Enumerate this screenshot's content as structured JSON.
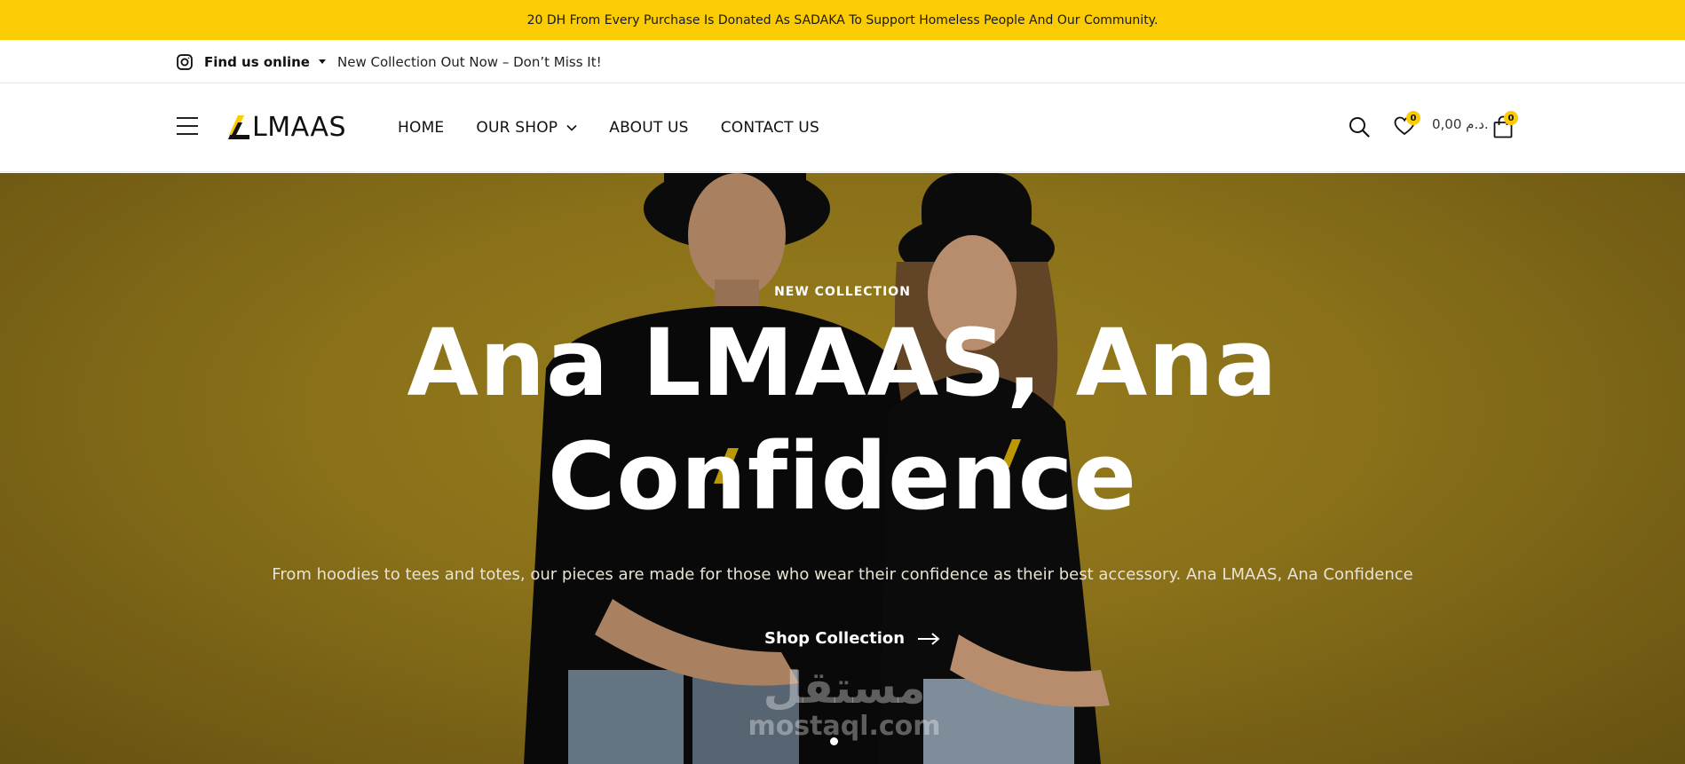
{
  "announcement": {
    "text": "20 DH From Every Purchase Is Donated As SADAKA To Support Homeless People And Our Community."
  },
  "topbar": {
    "find_us": "Find us online",
    "promo": "New Collection Out Now – Don’t Miss It!"
  },
  "header": {
    "logo_text": "LMAAS",
    "nav": [
      {
        "label": "HOME"
      },
      {
        "label": "OUR SHOP",
        "has_dropdown": true
      },
      {
        "label": "ABOUT US"
      },
      {
        "label": "CONTACT US"
      }
    ],
    "wishlist_count": "0",
    "cart_total": "0,00 د.م.",
    "cart_count": "0"
  },
  "hero": {
    "eyebrow": "NEW COLLECTION",
    "title": "Ana LMAAS, Ana Confidence",
    "subtitle": "From hoodies to tees and totes, our pieces are made for those who wear their confidence as their best accessory. Ana LMAAS, Ana Confidence",
    "cta": "Shop Collection",
    "watermark_ar": "مستقل",
    "watermark_en": "mostaql.com"
  },
  "colors": {
    "accent": "#fbcb04",
    "hero_bg": "#957a1c",
    "text": "#111111"
  },
  "icons": [
    "instagram-icon",
    "hamburger-icon",
    "search-icon",
    "heart-icon",
    "bag-icon",
    "chevron-down-icon",
    "arrow-right-icon"
  ]
}
